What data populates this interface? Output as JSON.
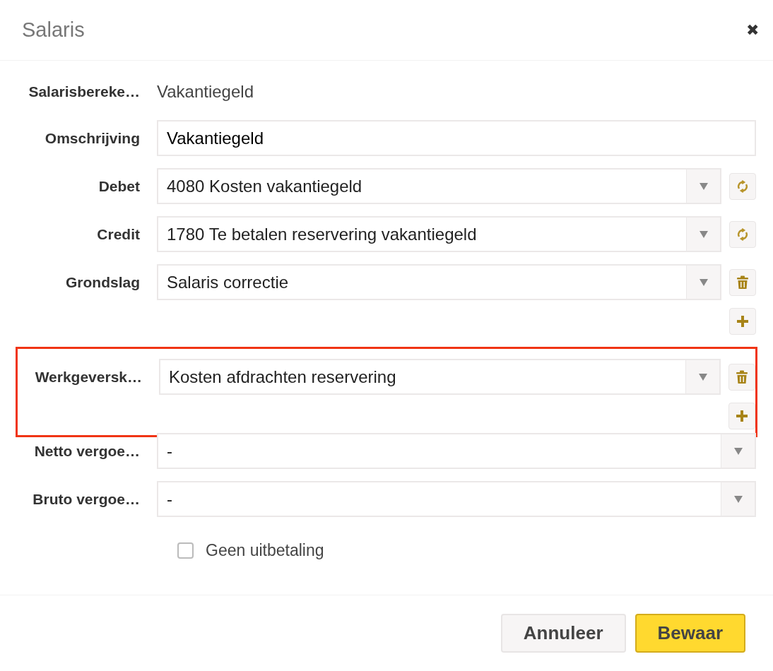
{
  "dialog": {
    "title": "Salaris",
    "close": "✖"
  },
  "sections": [
    {
      "highlighted": false,
      "rows": [
        {
          "kind": "static",
          "label": "Salarisbereke…",
          "value": "Vakantiegeld"
        },
        {
          "kind": "text",
          "label": "Omschrijving",
          "value": "Vakantiegeld"
        },
        {
          "kind": "select",
          "label": "Debet",
          "value": "4080 Kosten vakantiegeld",
          "button": {
            "kind": "swap"
          }
        },
        {
          "kind": "select",
          "label": "Credit",
          "value": "1780 Te betalen reservering vakantiegeld",
          "button": {
            "kind": "swap"
          }
        },
        {
          "kind": "select",
          "label": "Grondslag",
          "value": "Salaris correctie",
          "button": {
            "kind": "delete"
          }
        },
        {
          "kind": "add"
        }
      ]
    },
    {
      "highlighted": true,
      "rows": [
        {
          "kind": "select",
          "label": "Werkgeversk…",
          "value": "Kosten afdrachten reservering",
          "button": {
            "kind": "delete"
          }
        },
        {
          "kind": "add"
        }
      ]
    },
    {
      "highlighted": false,
      "rows": [
        {
          "kind": "select",
          "label": "Netto vergoe…",
          "value": "-"
        },
        {
          "kind": "select",
          "label": "Bruto vergoe…",
          "value": "-"
        },
        {
          "kind": "checkbox",
          "label": "Geen uitbetaling",
          "checked": false
        }
      ]
    }
  ],
  "buttons": [
    {
      "label": "Annuleer",
      "kind": "secondary"
    },
    {
      "label": "Bewaar",
      "kind": "primary"
    }
  ]
}
